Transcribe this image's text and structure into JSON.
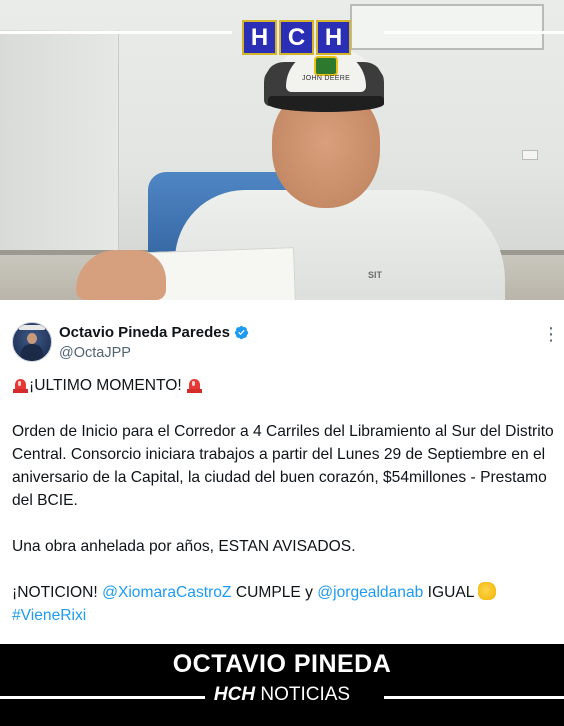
{
  "logo": {
    "letters": [
      "H",
      "C",
      "H"
    ],
    "colors": {
      "tile": "#2b2fb5",
      "border": "#d4b52a"
    }
  },
  "photo": {
    "cap_text": "JOHN DEERE",
    "shirt_text": "SIT"
  },
  "tweet": {
    "display_name": "Octavio Pineda Paredes",
    "handle": "@OctaJPP",
    "verified": true,
    "more_icon": "⋮",
    "headline": "¡ULTIMO MOMENTO!",
    "paragraph1": "Orden de Inicio para el Corredor a 4 Carriles del Libramiento al Sur del Distrito Central. Consorcio iniciara trabajos a partir del Lunes 29 de Septiembre en el aniversario de la Capital, la ciudad del buen corazón, $54millones - Prestamo del BCIE.",
    "paragraph2": "Una obra anhelada por años, ESTAN AVISADOS.",
    "p3_intro": "¡NOTICION!",
    "p3_mention1": "@XiomaraCastroZ",
    "p3_middle": "CUMPLE y",
    "p3_mention2": "@jorgealdanab",
    "p3_end": "IGUAL",
    "hashtag": "#VieneRixi",
    "colors": {
      "link": "#1d9bf0",
      "text": "#0f1419",
      "muted": "#536471",
      "verified": "#1d9bf0"
    }
  },
  "lower_third": {
    "title": "OCTAVIO PINEDA",
    "brand_bold": "HCH",
    "brand_rest": "NOTICIAS"
  }
}
